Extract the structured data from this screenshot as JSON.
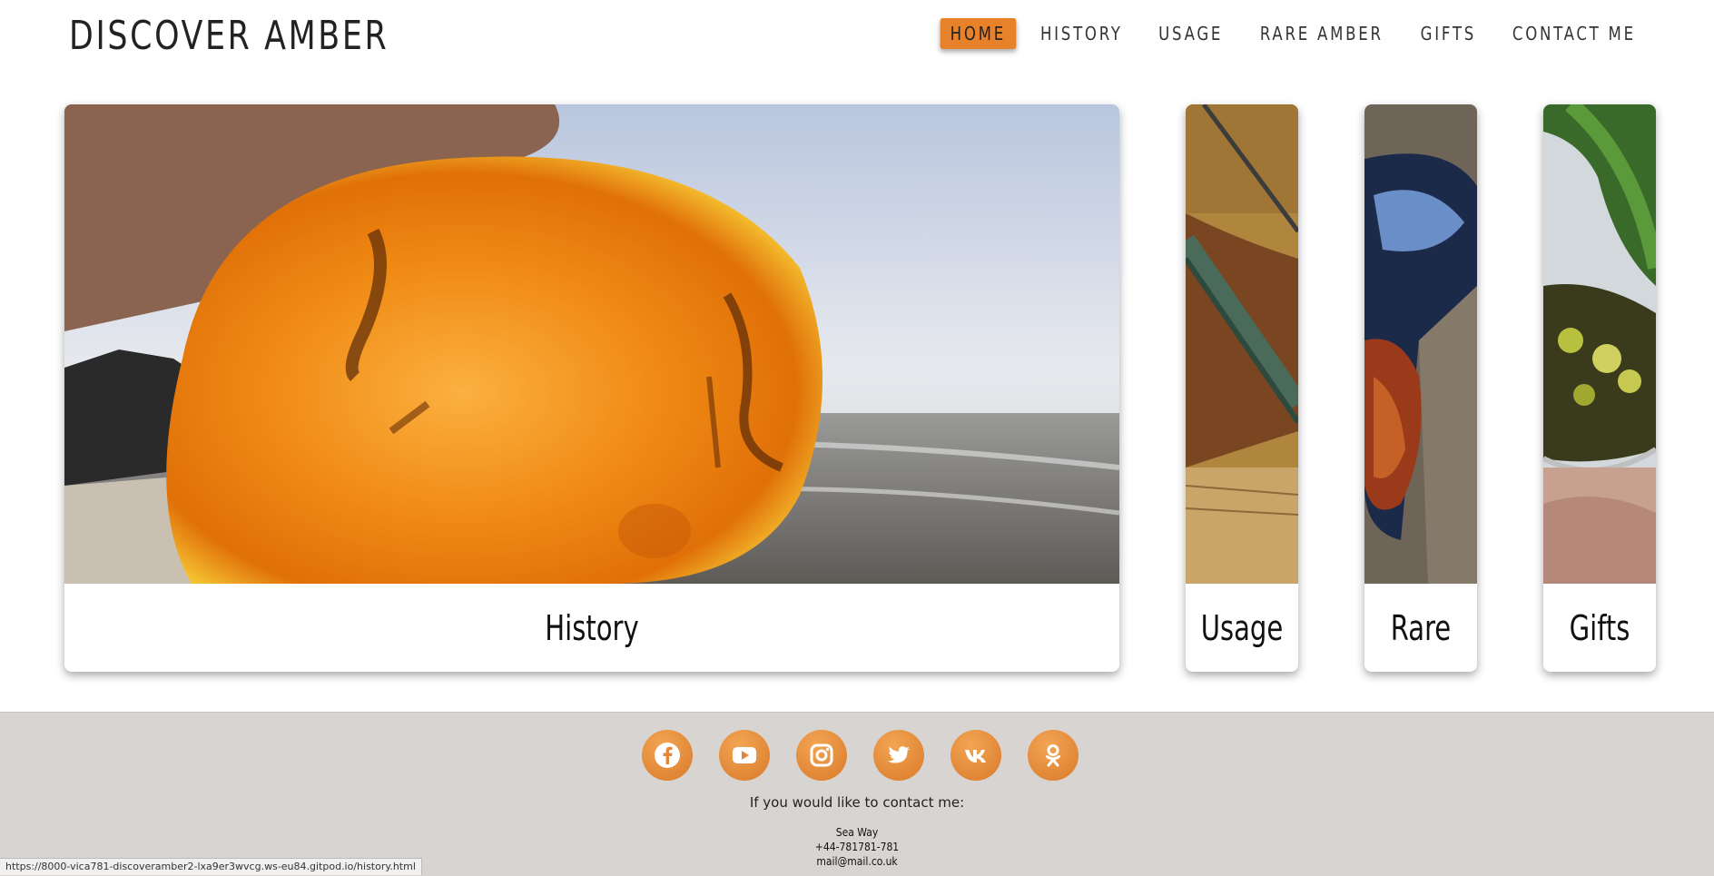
{
  "header": {
    "brand": "DISCOVER AMBER",
    "nav": [
      {
        "label": "HOME",
        "active": true
      },
      {
        "label": "HISTORY",
        "active": false
      },
      {
        "label": "USAGE",
        "active": false
      },
      {
        "label": "RARE AMBER",
        "active": false
      },
      {
        "label": "GIFTS",
        "active": false
      },
      {
        "label": "CONTACT ME",
        "active": false
      }
    ]
  },
  "cards": [
    {
      "caption": "History",
      "image": "amber-stone-beach-photo"
    },
    {
      "caption": "Usage",
      "image": "violin-photo"
    },
    {
      "caption": "Rare",
      "image": "blue-amber-photo"
    },
    {
      "caption": "Gifts",
      "image": "green-amber-ring-photo"
    }
  ],
  "footer": {
    "socials": [
      "facebook-icon",
      "youtube-icon",
      "instagram-icon",
      "twitter-icon",
      "vk-icon",
      "odnoklassniki-icon"
    ],
    "contact_intro": "If you would like to contact me:",
    "address": "Sea Way",
    "phone": "+44-781781-781",
    "email": "mail@mail.co.uk"
  },
  "status_bar": {
    "url": "https://8000-vica781-discoveramber2-lxa9er3wvcg.ws-eu84.gitpod.io/history.html"
  },
  "colors": {
    "accent": "#e8822a",
    "footer_bg": "#d8d4d2"
  }
}
